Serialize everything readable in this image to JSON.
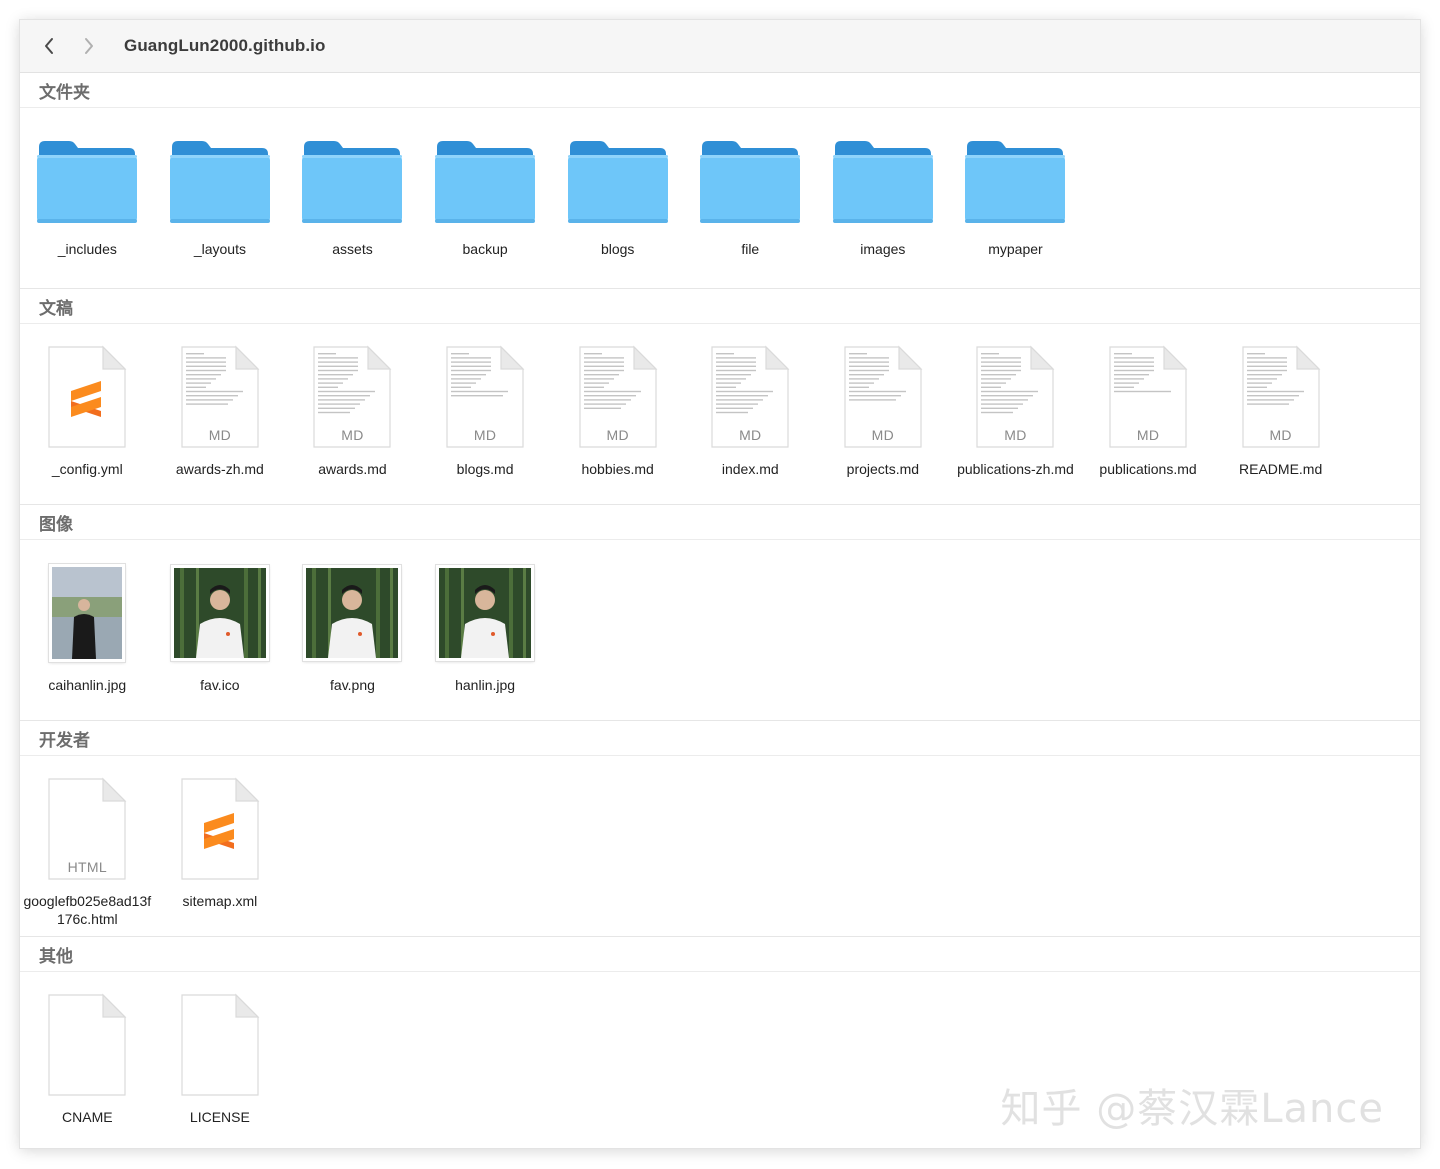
{
  "window": {
    "title": "GuangLun2000.github.io"
  },
  "colors": {
    "folder_back": "#2f93da",
    "folder_front": "#6ec6f9",
    "sublime_orange": "#fb8b1e"
  },
  "sections": {
    "folders": {
      "title": "文件夹",
      "items": [
        {
          "label": "_includes",
          "icon": "folder-icon"
        },
        {
          "label": "_layouts",
          "icon": "folder-icon"
        },
        {
          "label": "assets",
          "icon": "folder-icon"
        },
        {
          "label": "backup",
          "icon": "folder-icon"
        },
        {
          "label": "blogs",
          "icon": "folder-icon"
        },
        {
          "label": "file",
          "icon": "folder-icon"
        },
        {
          "label": "images",
          "icon": "folder-icon"
        },
        {
          "label": "mypaper",
          "icon": "folder-icon"
        }
      ]
    },
    "documents": {
      "title": "文稿",
      "items": [
        {
          "label": "_config.yml",
          "icon": "sublime-text-icon",
          "tag": ""
        },
        {
          "label": "awards-zh.md",
          "icon": "markdown-file-icon",
          "tag": "MD"
        },
        {
          "label": "awards.md",
          "icon": "markdown-file-icon",
          "tag": "MD"
        },
        {
          "label": "blogs.md",
          "icon": "markdown-file-icon",
          "tag": "MD"
        },
        {
          "label": "hobbies.md",
          "icon": "markdown-file-icon",
          "tag": "MD"
        },
        {
          "label": "index.md",
          "icon": "markdown-file-icon",
          "tag": "MD"
        },
        {
          "label": "projects.md",
          "icon": "markdown-file-icon",
          "tag": "MD"
        },
        {
          "label": "publications-zh.md",
          "icon": "markdown-file-icon",
          "tag": "MD"
        },
        {
          "label": "publications.md",
          "icon": "markdown-file-icon",
          "tag": "MD"
        },
        {
          "label": "README.md",
          "icon": "markdown-file-icon",
          "tag": "MD"
        }
      ]
    },
    "images": {
      "title": "图像",
      "items": [
        {
          "label": "caihanlin.jpg",
          "icon": "photo-thumbnail-icon"
        },
        {
          "label": "fav.ico",
          "icon": "photo-thumbnail-icon"
        },
        {
          "label": "fav.png",
          "icon": "photo-thumbnail-icon"
        },
        {
          "label": "hanlin.jpg",
          "icon": "photo-thumbnail-icon"
        }
      ]
    },
    "developer": {
      "title": "开发者",
      "items": [
        {
          "label": "googlefb025e8ad13f176c.html",
          "icon": "html-file-icon",
          "tag": "HTML"
        },
        {
          "label": "sitemap.xml",
          "icon": "sublime-text-icon",
          "tag": ""
        }
      ]
    },
    "other": {
      "title": "其他",
      "items": [
        {
          "label": "CNAME",
          "icon": "blank-file-icon"
        },
        {
          "label": "LICENSE",
          "icon": "blank-file-icon"
        }
      ]
    }
  },
  "watermark": "知乎 @蔡汉霖Lance"
}
